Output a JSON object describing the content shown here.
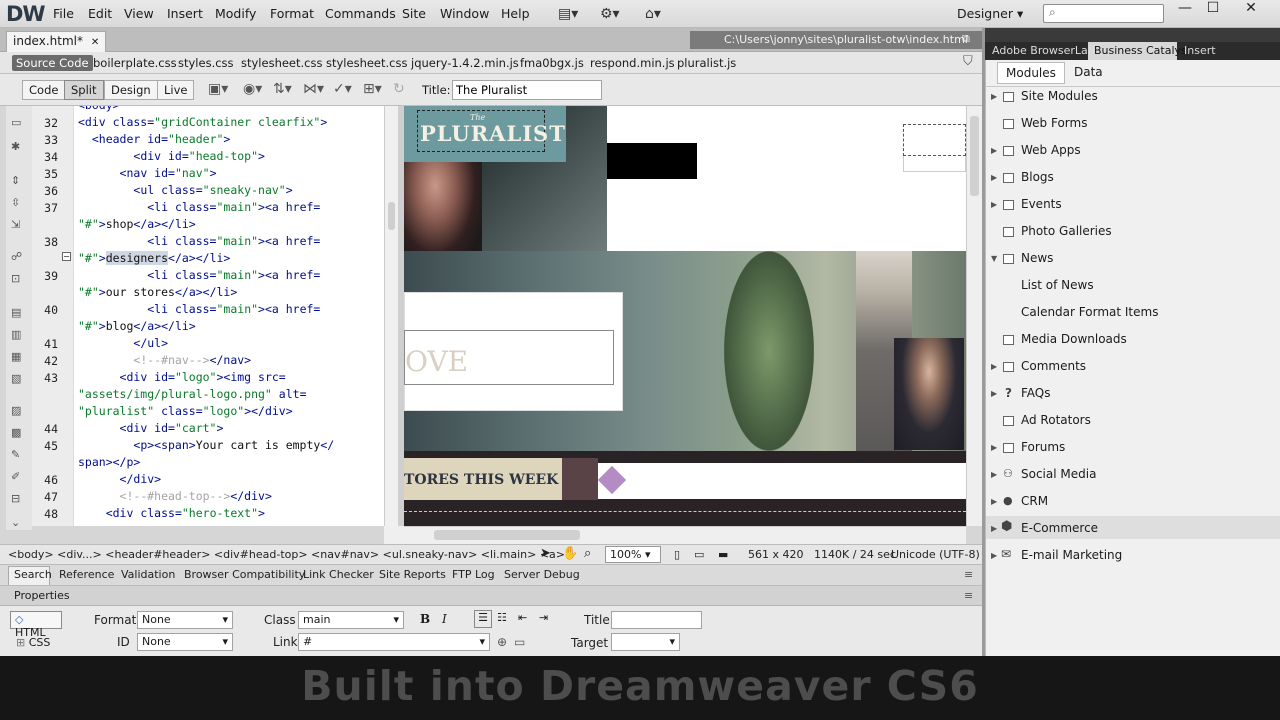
{
  "app": {
    "logo": "DW",
    "menu": [
      "File",
      "Edit",
      "View",
      "Insert",
      "Modify",
      "Format",
      "Commands",
      "Site",
      "Window",
      "Help"
    ],
    "workspace": "Designer",
    "workspace_arrow": "▾",
    "search_icon": "⌕",
    "window_controls": [
      "—",
      "☐",
      "✕"
    ]
  },
  "document": {
    "tab": "index.html*",
    "tab_close": "✕",
    "path": "C:\\Users\\jonny\\sites\\pluralist-otw\\index.html"
  },
  "related_files": {
    "active": "Source Code",
    "files": [
      "boilerplate.css",
      "styles.css",
      "stylesheet.css",
      "stylesheet.css",
      "jquery-1.4.2.min.js",
      "fma0bgx.js",
      "respond.min.js",
      "pluralist.js"
    ]
  },
  "doc_toolbar": {
    "views": [
      "Code",
      "Split",
      "Design",
      "Live"
    ],
    "active_view": "Split",
    "title_label": "Title:",
    "title_value": "The Pluralist"
  },
  "code": {
    "lines": [
      {
        "n": "",
        "html": "<span class='t'>&lt;body&gt;</span>"
      },
      {
        "n": "32",
        "html": "<span class='t'>&lt;div class=</span><span class='a'>\"gridContainer clearfix\"</span><span class='t'>&gt;</span>"
      },
      {
        "n": "33",
        "html": "  <span class='t'>&lt;header id=</span><span class='a'>\"header\"</span><span class='t'>&gt;</span>"
      },
      {
        "n": "34",
        "html": "        <span class='t'>&lt;div id=</span><span class='a'>\"head-top\"</span><span class='t'>&gt;</span>"
      },
      {
        "n": "35",
        "html": "      <span class='t'>&lt;nav id=</span><span class='a'>\"nav\"</span><span class='t'>&gt;</span>"
      },
      {
        "n": "36",
        "html": "        <span class='t'>&lt;ul class=</span><span class='a'>\"sneaky-nav\"</span><span class='t'>&gt;</span>"
      },
      {
        "n": "37",
        "html": "          <span class='t'>&lt;li class=</span><span class='a'>\"main\"</span><span class='t'>&gt;&lt;a href=</span>"
      },
      {
        "n": "",
        "html": "<span class='a'>\"#\"</span><span class='t'>&gt;</span><span class='x'>shop</span><span class='t'>&lt;/a&gt;&lt;/li&gt;</span>"
      },
      {
        "n": "38",
        "html": "          <span class='t'>&lt;li class=</span><span class='a'>\"main\"</span><span class='t'>&gt;&lt;a href=</span>"
      },
      {
        "n": "",
        "html": "<span class='a'>\"#\"</span><span class='t'>&gt;</span><span class='x hl'>designers</span><span class='t'>&lt;/a&gt;&lt;/li&gt;</span>"
      },
      {
        "n": "39",
        "html": "          <span class='t'>&lt;li class=</span><span class='a'>\"main\"</span><span class='t'>&gt;&lt;a href=</span>"
      },
      {
        "n": "",
        "html": "<span class='a'>\"#\"</span><span class='t'>&gt;</span><span class='x'>our stores</span><span class='t'>&lt;/a&gt;&lt;/li&gt;</span>"
      },
      {
        "n": "40",
        "html": "          <span class='t'>&lt;li class=</span><span class='a'>\"main\"</span><span class='t'>&gt;&lt;a href=</span>"
      },
      {
        "n": "",
        "html": "<span class='a'>\"#\"</span><span class='t'>&gt;</span><span class='x'>blog</span><span class='t'>&lt;/a&gt;&lt;/li&gt;</span>"
      },
      {
        "n": "41",
        "html": "        <span class='t'>&lt;/ul&gt;</span>"
      },
      {
        "n": "42",
        "html": "        <span class='cm'>&lt;!--#nav--&gt;</span><span class='t'>&lt;/nav&gt;</span>"
      },
      {
        "n": "43",
        "html": "      <span class='t'>&lt;div id=</span><span class='a'>\"logo\"</span><span class='t'>&gt;&lt;img src=</span>"
      },
      {
        "n": "",
        "html": "<span class='a'>\"assets/img/plural-logo.png\"</span><span class='t'> alt=</span>"
      },
      {
        "n": "",
        "html": "<span class='a'>\"pluralist\"</span><span class='t'> class=</span><span class='a'>\"logo\"</span><span class='t'>&gt;&lt;/div&gt;</span>"
      },
      {
        "n": "44",
        "html": "      <span class='t'>&lt;div id=</span><span class='a'>\"cart\"</span><span class='t'>&gt;</span>"
      },
      {
        "n": "45",
        "html": "        <span class='t'>&lt;p&gt;&lt;span&gt;</span><span class='x'>Your cart is empty</span><span class='t'>&lt;/</span>"
      },
      {
        "n": "",
        "html": "<span class='t'>span&gt;&lt;/p&gt;</span>"
      },
      {
        "n": "46",
        "html": "      <span class='t'>&lt;/div&gt;</span>"
      },
      {
        "n": "47",
        "html": "      <span class='cm'>&lt;!--#head-top--&gt;</span><span class='t'>&lt;/div&gt;</span>"
      },
      {
        "n": "48",
        "html": "    <span class='t'>&lt;div class=</span><span class='a'>\"hero-text\"</span><span class='t'>&gt;</span>"
      }
    ]
  },
  "design_view": {
    "logo_small": "The",
    "logo": "PLURALIST",
    "ove_text": "OVE",
    "stores_text": "TORES THIS WEEK"
  },
  "status": {
    "breadcrumb": "<body> <div...> <header#header> <div#head-top> <nav#nav> <ul.sneaky-nav> <li.main> <a>",
    "zoom": "100%",
    "size": "561 x 420",
    "download": "1140K / 24 sec",
    "encoding": "Unicode (UTF-8)"
  },
  "panel_tabs": [
    "Search",
    "Reference",
    "Validation",
    "Browser Compatibility",
    "Link Checker",
    "Site Reports",
    "FTP Log",
    "Server Debug"
  ],
  "properties": {
    "title": "Properties",
    "html": "HTML",
    "css": "CSS",
    "format_label": "Format",
    "format_value": "None",
    "id_label": "ID",
    "id_value": "None",
    "class_label": "Class",
    "class_value": "main",
    "link_label": "Link",
    "link_value": "#",
    "title_label": "Title",
    "target_label": "Target",
    "bold": "B",
    "italic": "I"
  },
  "right_panel": {
    "tabs": [
      "Adobe BrowserLab",
      "Business Catalyst",
      "Insert"
    ],
    "active_tab": "Business Catalyst",
    "subtabs": [
      "Modules",
      "Data"
    ],
    "items": [
      "Site Modules",
      "Web Forms",
      "Web Apps",
      "Blogs",
      "Events",
      "Photo Galleries",
      "News",
      "List of News",
      "Calendar Format Items",
      "Media Downloads",
      "Comments",
      "FAQs",
      "Ad Rotators",
      "Forums",
      "Social Media",
      "CRM",
      "E-Commerce",
      "E-mail Marketing"
    ]
  },
  "banner": {
    "text": "Built into Dreamweaver CS6"
  }
}
